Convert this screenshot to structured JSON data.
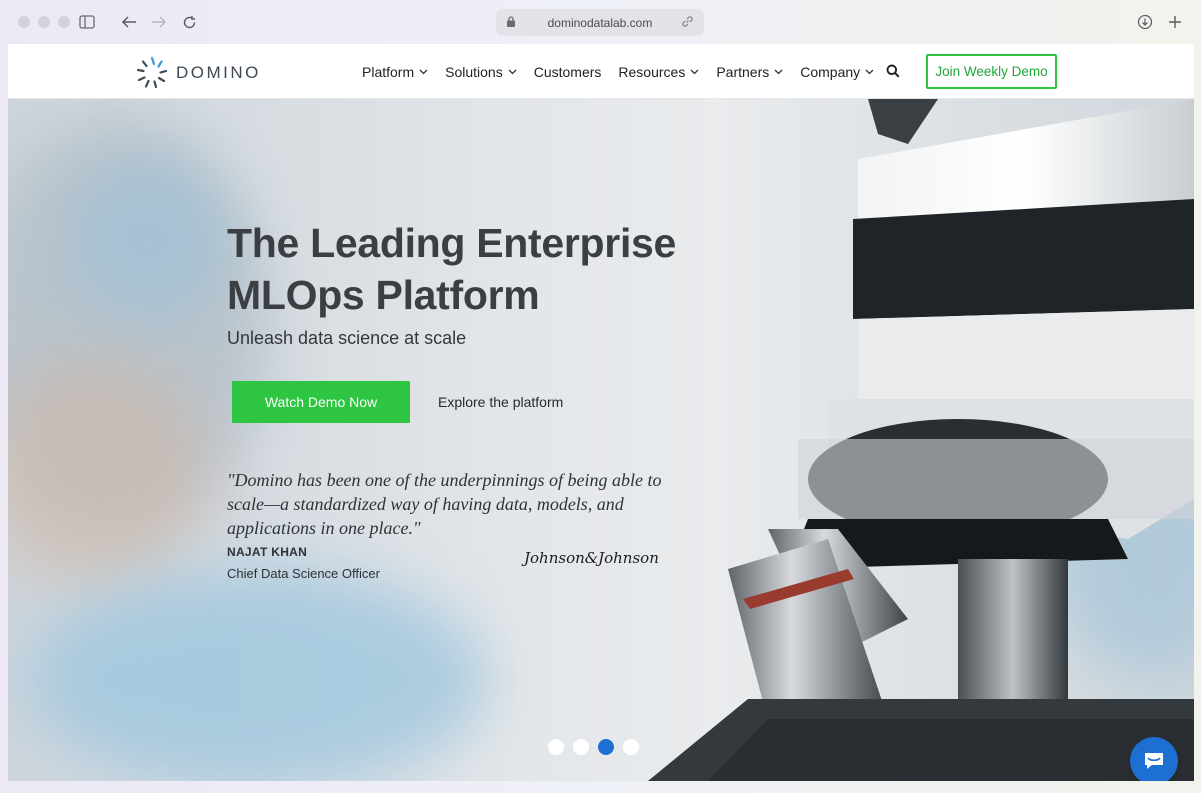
{
  "browser": {
    "url": "dominodatalab.com",
    "icons": [
      "sidebar-icon",
      "back-icon",
      "forward-icon",
      "reload-icon",
      "lock-icon",
      "link-icon",
      "download-icon",
      "new-tab-icon"
    ]
  },
  "nav": {
    "logo_text": "DOMINO",
    "items": [
      {
        "label": "Platform",
        "has_dropdown": true
      },
      {
        "label": "Solutions",
        "has_dropdown": true
      },
      {
        "label": "Customers",
        "has_dropdown": false
      },
      {
        "label": "Resources",
        "has_dropdown": true
      },
      {
        "label": "Partners",
        "has_dropdown": true
      },
      {
        "label": "Company",
        "has_dropdown": true
      }
    ],
    "cta_label": "Join Weekly Demo",
    "accent": "#2dc542"
  },
  "hero": {
    "headline": "The Leading Enterprise MLOps Platform",
    "subhead": "Unleash data science at scale",
    "primary_cta": "Watch Demo Now",
    "secondary_cta": "Explore the platform",
    "quote": "\"Domino has been one of the underpinnings of being able to scale—a standardized way of having data, models, and applications in one place.\"",
    "author_name": "NAJAT KHAN",
    "author_title": "Chief Data Science Officer",
    "company_logo": "Johnson&Johnson",
    "carousel": {
      "count": 4,
      "active": 3
    },
    "chat_color": "#1d6fd1"
  }
}
